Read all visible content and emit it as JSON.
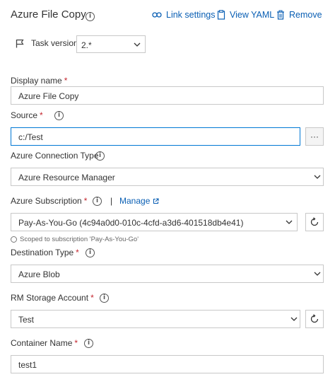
{
  "header": {
    "title": "Azure File Copy",
    "link_settings": "Link settings",
    "view_yaml": "View YAML",
    "remove": "Remove"
  },
  "task_version": {
    "label": "Task version",
    "value": "2.*"
  },
  "display_name": {
    "label": "Display name",
    "required": "*",
    "value": "Azure File Copy"
  },
  "source": {
    "label": "Source",
    "required": "*",
    "value": "c:/Test",
    "browse_label": "···"
  },
  "azure_connection_type": {
    "label": "Azure Connection Type",
    "value": "Azure Resource Manager"
  },
  "azure_subscription": {
    "label": "Azure Subscription",
    "required": "*",
    "separator": "|",
    "manage_label": "Manage",
    "value": "Pay-As-You-Go (4c94a0d0-010c-4cfd-a3d6-401518db4e41)",
    "scope_note": "Scoped to subscription 'Pay-As-You-Go'"
  },
  "destination_type": {
    "label": "Destination Type",
    "required": "*",
    "value": "Azure Blob"
  },
  "rm_storage_account": {
    "label": "RM Storage Account",
    "required": "*",
    "value": "Test"
  },
  "container_name": {
    "label": "Container Name",
    "required": "*",
    "value": "test1"
  },
  "colors": {
    "link": "#0a5fb4",
    "required": "#c4262e",
    "focus_border": "#0078d4",
    "field_border": "#c8c8c8"
  },
  "icons": [
    "info-icon",
    "link-icon",
    "yaml-icon",
    "trash-icon",
    "flag-icon",
    "chevron-down-icon",
    "refresh-icon",
    "external-link-icon",
    "ellipsis-icon"
  ]
}
